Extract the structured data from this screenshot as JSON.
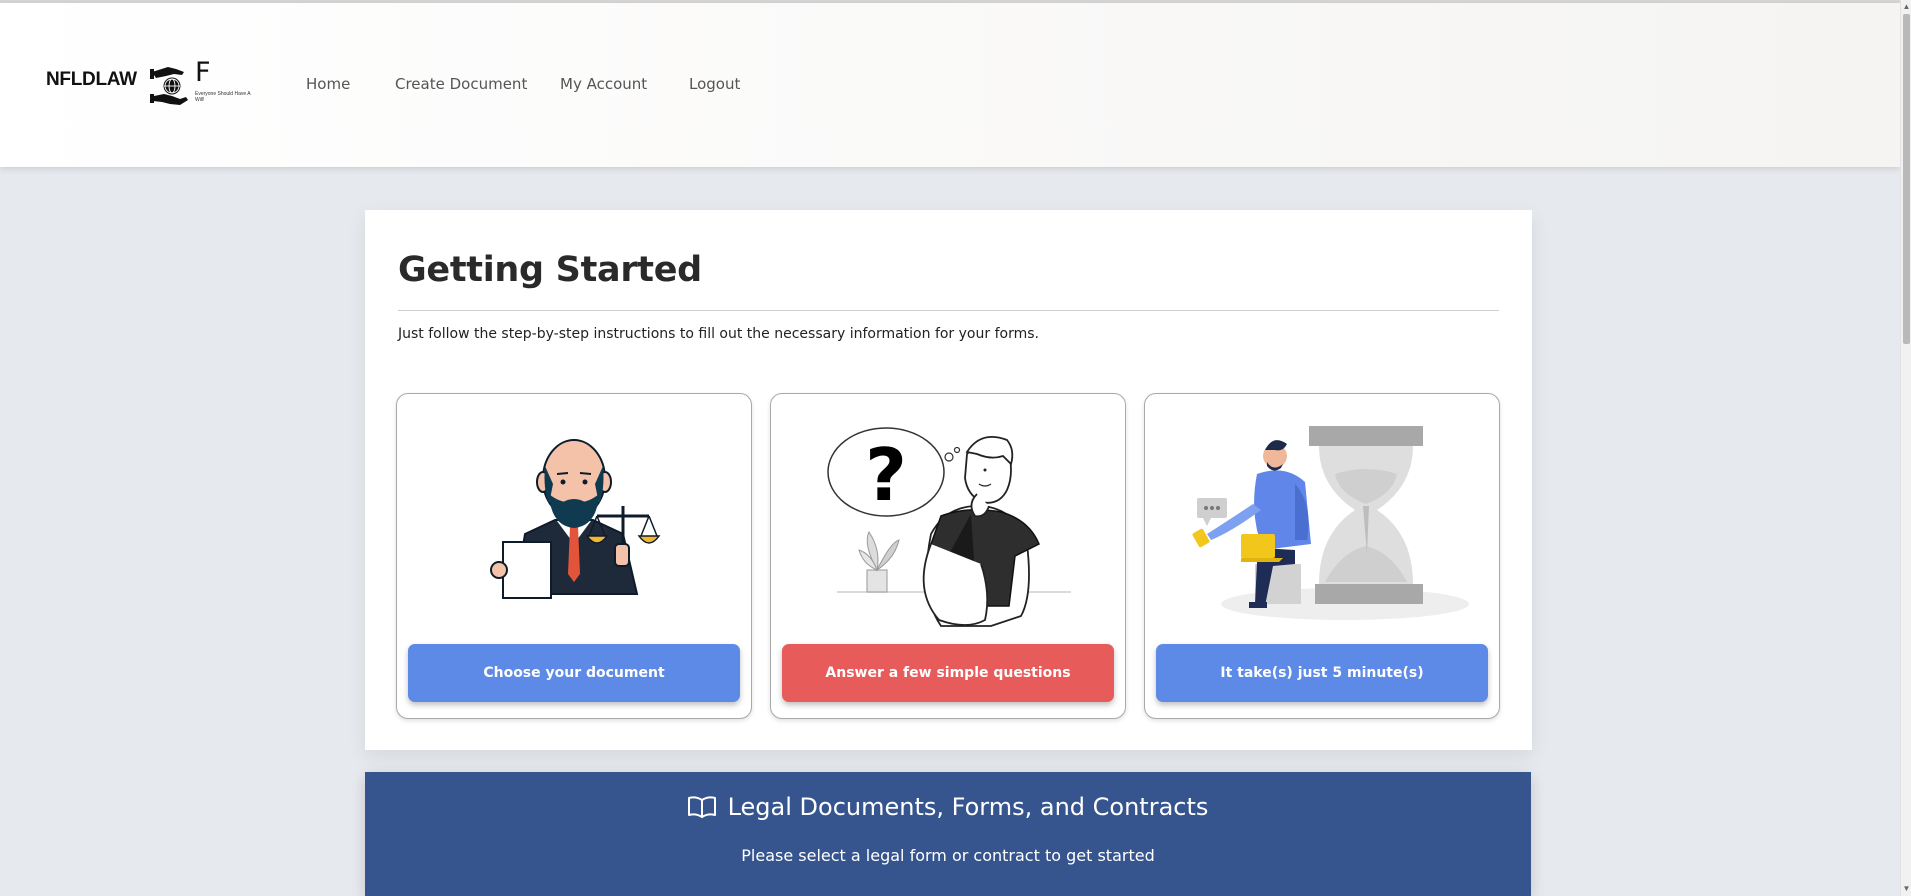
{
  "header": {
    "brand": "NFLDLAW",
    "logo_letter": "F",
    "logo_tagline": "Everyone Should Have A Will!",
    "nav": [
      {
        "label": "Home"
      },
      {
        "label": "Create Document"
      },
      {
        "label": "My Account"
      },
      {
        "label": "Logout"
      }
    ]
  },
  "getting_started": {
    "title": "Getting Started",
    "intro": "Just follow the step-by-step instructions to fill out the necessary information for your forms.",
    "steps": [
      {
        "label": "Choose your document",
        "icon": "lawyer-illustration",
        "color": "#5c8ae6"
      },
      {
        "label": "Answer a few simple questions",
        "icon": "thinking-person-illustration",
        "color": "#e85b5b"
      },
      {
        "label": "It take(s) just 5 minute(s)",
        "icon": "hourglass-illustration",
        "color": "#5c8ae6"
      }
    ]
  },
  "banner": {
    "icon": "book-icon",
    "title": "Legal Documents, Forms, and Contracts",
    "subtitle": "Please select a legal form or contract to get started"
  },
  "colors": {
    "page_bg": "#e6e9ee",
    "banner_bg": "#36558f",
    "primary_blue": "#5c8ae6",
    "accent_red": "#e85b5b"
  }
}
